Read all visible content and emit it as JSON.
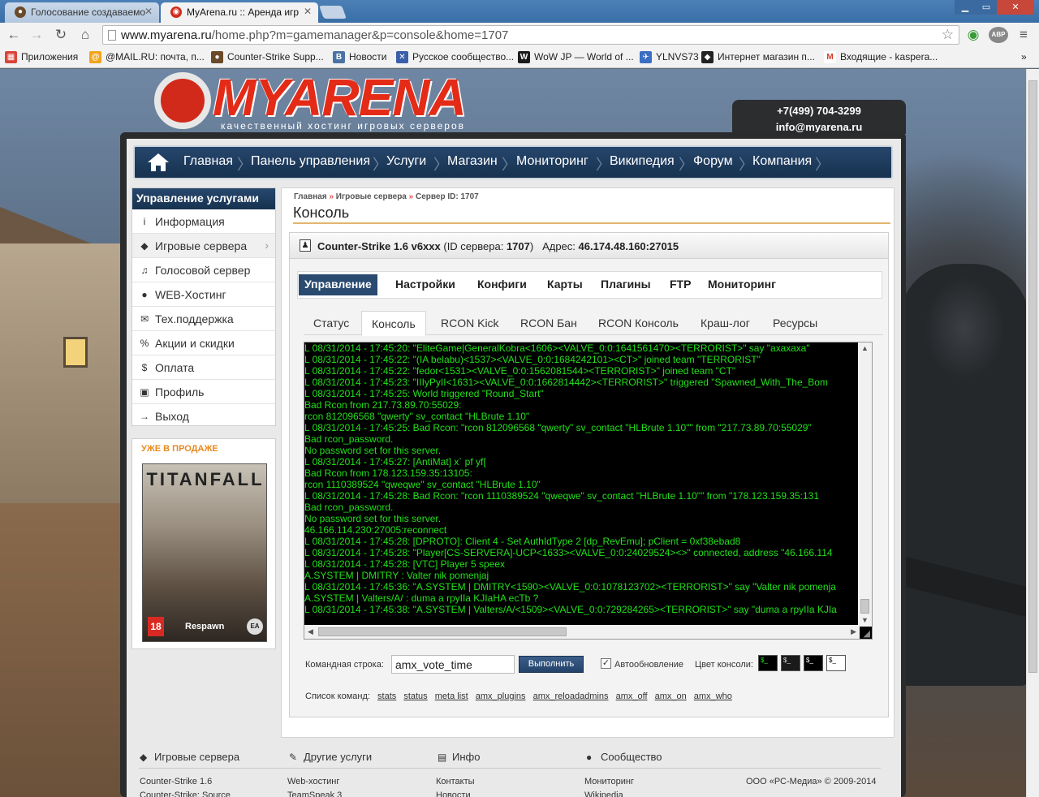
{
  "browser": {
    "tabs": [
      {
        "title": "Голосование создаваемо",
        "icon": "person-icon"
      },
      {
        "title": "MyArena.ru :: Аренда игр",
        "icon": "myarena-favicon"
      }
    ],
    "url_host": "www.myarena.ru",
    "url_path": "/home.php?m=gamemanager&p=console&home=1707",
    "bookmarks": [
      {
        "label": "Приложения",
        "icon": "apps-icon",
        "color": "#d9443a"
      },
      {
        "label": "@MAIL.RU: почта, п...",
        "icon": "mailru-icon",
        "color": "#f2a51a"
      },
      {
        "label": "Counter-Strike Supp...",
        "icon": "steam-user-icon",
        "color": "#6a4a2a"
      },
      {
        "label": "Новости",
        "icon": "vk-icon",
        "color": "#4a73a5"
      },
      {
        "label": "Русское сообщество...",
        "icon": "x-icon",
        "color": "#3b5ea8"
      },
      {
        "label": "WoW JP — World of ...",
        "icon": "wow-icon",
        "color": "#1b1b1b"
      },
      {
        "label": "YLNVS73",
        "icon": "bird-icon",
        "color": "#3a6fc4"
      },
      {
        "label": "Интернет магазин п...",
        "icon": "shop-icon",
        "color": "#222222"
      },
      {
        "label": "Входящие - kaspera...",
        "icon": "gmail-icon",
        "color": "#d23b2b"
      }
    ],
    "ext_abp": "ABP"
  },
  "header": {
    "logo_text": "MYARENA",
    "logo_sub": "качественный хостинг игровых серверов",
    "phone": "+7(499) 704-3299",
    "email": "info@myarena.ru"
  },
  "nav": [
    "Главная",
    "Панель управления",
    "Услуги",
    "Магазин",
    "Мониторинг",
    "Википедия",
    "Форум",
    "Компания"
  ],
  "sidebar": {
    "title": "Управление услугами",
    "items": [
      {
        "label": "Информация",
        "icon": "info-icon",
        "glyph": "i"
      },
      {
        "label": "Игровые сервера",
        "icon": "gamepad-icon",
        "glyph": "◆"
      },
      {
        "label": "Голосовой сервер",
        "icon": "headset-icon",
        "glyph": "♫"
      },
      {
        "label": "WEB-Хостинг",
        "icon": "globe-icon",
        "glyph": "●"
      },
      {
        "label": "Тех.поддержка",
        "icon": "support-chat-icon",
        "glyph": "✉"
      },
      {
        "label": "Акции и скидки",
        "icon": "percent-icon",
        "glyph": "%"
      },
      {
        "label": "Оплата",
        "icon": "dollar-icon",
        "glyph": "$"
      },
      {
        "label": "Профиль",
        "icon": "profile-card-icon",
        "glyph": "▣"
      },
      {
        "label": "Выход",
        "icon": "logout-icon",
        "glyph": "→"
      }
    ]
  },
  "promo": {
    "label": "УЖЕ В ПРОДАЖЕ",
    "title": "TITANFALL",
    "rating": "18",
    "brand": "Respawn",
    "publisher": "EA"
  },
  "content": {
    "breadcrumb": [
      "Главная",
      "Игровые сервера",
      "Сервер ID: 1707"
    ],
    "title": "Консоль",
    "server": {
      "name": "Counter-Strike 1.6 v6xxx",
      "id_label": "(ID сервера:",
      "id": "1707",
      "id_close": ")",
      "addr_label": "Адрес:",
      "addr": "46.174.48.160:27015"
    },
    "main_tabs": [
      "Управление",
      "Настройки",
      "Конфиги",
      "Карты",
      "Плагины",
      "FTP",
      "Мониторинг"
    ],
    "sub_tabs": [
      "Статус",
      "Консоль",
      "RCON Kick",
      "RCON Бан",
      "RCON Консоль",
      "Краш-лог",
      "Ресурсы"
    ],
    "console_lines": [
      "L 08/31/2014 - 17:45:20: \"EliteGame|GeneralKobra<1606><VALVE_0:0:1641561470><TERRORIST>\" say \"ахахаха\"",
      "L 08/31/2014 - 17:45:22: \"(IA belabu)<1537><VALVE_0:0:1684242101><CT>\" joined team \"TERRORIST\"",
      "L 08/31/2014 - 17:45:22: \"fedor<1531><VALVE_0:0:1562081544><TERRORIST>\" joined team \"CT\"",
      "L 08/31/2014 - 17:45:23: \"IIIyPyII<1631><VALVE_0:0:1662814442><TERRORIST>\" triggered \"Spawned_With_The_Bom",
      "L 08/31/2014 - 17:45:25: World triggered \"Round_Start\"",
      "Bad Rcon from 217.73.89.70:55029:",
      "rcon 812096568 \"qwerty\"  sv_contact \"HLBrute 1.10\"",
      "L 08/31/2014 - 17:45:25: Bad Rcon: \"rcon 812096568 \"qwerty\"  sv_contact \"HLBrute 1.10\"\" from \"217.73.89.70:55029\"",
      "Bad rcon_password.",
      "No password set for this server.",
      "L 08/31/2014 - 17:45:27: [AntiMat] х`  pf yf[",
      "Bad Rcon from 178.123.159.35:13105:",
      "rcon 1110389524 \"qweqwe\"  sv_contact \"HLBrute 1.10\"",
      "L 08/31/2014 - 17:45:28: Bad Rcon: \"rcon 1110389524 \"qweqwe\"  sv_contact \"HLBrute 1.10\"\" from \"178.123.159.35:131",
      "Bad rcon_password.",
      "No password set for this server.",
      "46.166.114.230:27005:reconnect",
      "L 08/31/2014 - 17:45:28: [DPROTO]: Client 4 - Set AuthIdType 2 [dp_RevEmu]; pClient = 0xf38ebad8",
      "L 08/31/2014 - 17:45:28: \"Player[CS-SERVERA]-UCP<1633><VALVE_0:0:24029524><>\" connected, address \"46.166.114",
      "L 08/31/2014 - 17:45:28: [VTC] Player 5 speex",
      "A.SYSTEM | DMITRY : Valter nik pomenjaj",
      "L 08/31/2014 - 17:45:36: \"A.SYSTEM | DMITRY<1590><VALVE_0:0:1078123702><TERRORIST>\" say \"Valter nik pomenja",
      "A.SYSTEM | Valters/A/ : duma a rpyIIa KJIaHA ecTb ?",
      "L 08/31/2014 - 17:45:38: \"A.SYSTEM | Valters/A/<1509><VALVE_0:0:729284265><TERRORIST>\" say \"duma a rpyIIa KJIa"
    ],
    "cmd_label": "Командная строка:",
    "cmd_value": "amx_vote_time",
    "exec_label": "Выполнить",
    "autoupdate_label": "Автообновление",
    "autoupdate_checked": "✓",
    "color_label": "Цвет консоли:",
    "color_swatches": [
      {
        "bg": "#000000",
        "fg": "#22e01a",
        "text": "$_"
      },
      {
        "bg": "#1a1a1a",
        "fg": "#dddddd",
        "text": "$_"
      },
      {
        "bg": "#000000",
        "fg": "#ffffff",
        "text": "$_"
      },
      {
        "bg": "#ffffff",
        "fg": "#000000",
        "text": "$_"
      }
    ],
    "cmdlist_label": "Список команд:",
    "commands": [
      "stats",
      "status",
      "meta list",
      "amx_plugins",
      "amx_reloadadmins",
      "amx_off",
      "amx_on",
      "amx_who"
    ]
  },
  "footer": {
    "columns": [
      {
        "title": "Игровые сервера",
        "icon": "gamepad-icon",
        "links": [
          "Counter-Strike 1.6",
          "Counter-Strike: Source"
        ]
      },
      {
        "title": "Другие услуги",
        "icon": "pen-icon",
        "links": [
          "Web-хостинг",
          "TeamSpeak 3"
        ]
      },
      {
        "title": "Инфо",
        "icon": "doc-icon",
        "links": [
          "Контакты",
          "Новости"
        ]
      },
      {
        "title": "Сообщество",
        "icon": "chat-icon",
        "links": [
          "Мониторинг",
          "Wikipedia"
        ]
      }
    ],
    "copyright": "ООО «РС-Медиа» © 2009-2014"
  }
}
